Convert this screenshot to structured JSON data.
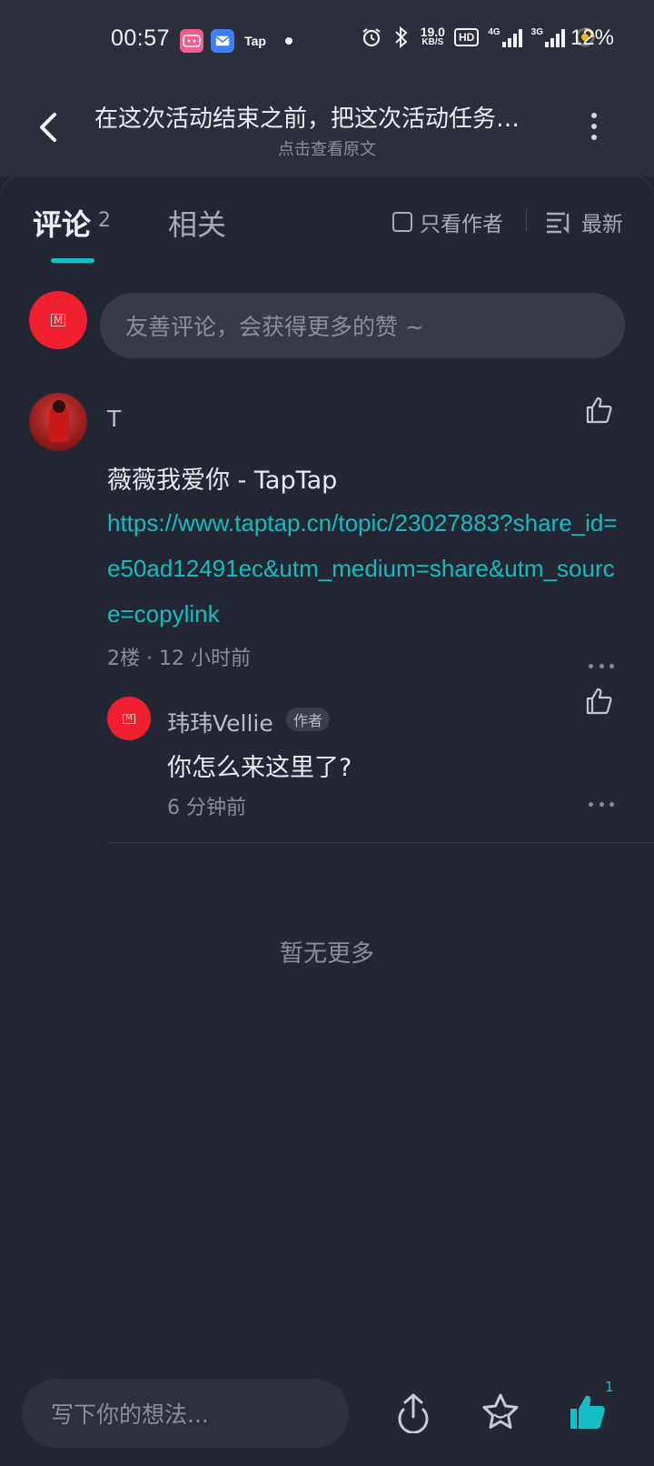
{
  "status_bar": {
    "time": "00:57",
    "apps": [
      "weibo",
      "mail",
      "Tap"
    ],
    "net_speed_value": "19.0",
    "net_speed_unit": "KB/S",
    "hd_label": "HD",
    "signal1_label": "4G",
    "signal2_label": "3G",
    "battery": "12%"
  },
  "header": {
    "title": "在这次活动结束之前，把这次活动任务…",
    "subtitle": "点击查看原文"
  },
  "tabs": {
    "comments_label": "评论",
    "comments_count": "2",
    "related_label": "相关",
    "author_only_label": "只看作者",
    "sort_label": "最新"
  },
  "composer": {
    "placeholder": "友善评论，会获得更多的赞 ~"
  },
  "comments": [
    {
      "user": "T",
      "text": "薇薇我爱你 - TapTap",
      "link": "https://www.taptap.cn/topic/23027883?share_id=e50ad12491ec&utm_medium=share&utm_source=copylink",
      "meta": "2楼 · 12 小时前",
      "reply": {
        "user": "玮玮Vellie",
        "badge": "作者",
        "text": "你怎么来这里了?",
        "time": "6 分钟前"
      }
    }
  ],
  "footer_note": "暂无更多",
  "bottom_bar": {
    "placeholder": "写下你的想法...",
    "like_count": "1"
  },
  "colors": {
    "accent": "#14c0c6",
    "background": "#232734",
    "avatar_red": "#f01f30"
  }
}
